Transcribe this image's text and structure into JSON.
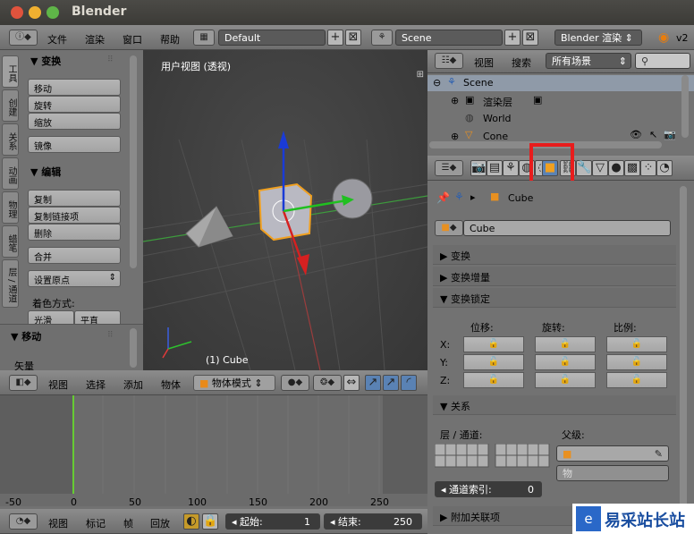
{
  "window": {
    "title": "Blender"
  },
  "top_header": {
    "menus": [
      "文件",
      "渲染",
      "窗口",
      "帮助"
    ],
    "screen_layout": "Default",
    "scene": "Scene",
    "render_engine": "Blender 渲染",
    "version": "v2"
  },
  "tool_shelf": {
    "tabs": [
      "工具",
      "创建",
      "关系",
      "动画",
      "物理",
      "蜡笔",
      "层 / 通道"
    ],
    "transform_header": "▼ 变换",
    "transform_buttons": [
      "移动",
      "旋转",
      "缩放",
      "镜像"
    ],
    "edit_header": "▼ 编辑",
    "edit_buttons": [
      "复制",
      "复制链接项",
      "删除",
      "合并"
    ],
    "set_origin": "设置原点",
    "shading_label": "着色方式:",
    "shading_buttons": [
      "光滑",
      "平直"
    ],
    "operator_header": "▼ 移动",
    "operator_field": "矢量"
  },
  "viewport": {
    "label": "用户视图 (透视)",
    "object_label": "(1) Cube"
  },
  "view3d_header": {
    "menus": [
      "视图",
      "选择",
      "添加",
      "物体"
    ],
    "mode": "物体模式"
  },
  "outliner": {
    "menus": [
      "视图",
      "搜索"
    ],
    "filter": "所有场景",
    "tree": [
      {
        "label": "Scene"
      },
      {
        "label": "渲染层"
      },
      {
        "label": "World"
      },
      {
        "label": "Cone"
      }
    ]
  },
  "properties": {
    "breadcrumb": "Cube",
    "object_name": "Cube",
    "panels": {
      "transform": "▶ 变换",
      "delta_transform": "▶ 变换增量",
      "transform_lock": "▼ 变换锁定",
      "relations": "▼ 关系",
      "attach": "▶ 附加关联项"
    },
    "lock_columns": [
      "位移:",
      "旋转:",
      "比例:"
    ],
    "lock_rows": [
      "X:",
      "Y:",
      "Z:"
    ],
    "layers_label": "层 / 通道:",
    "parent_label": "父级:",
    "pass_index_label": "通道索引:",
    "pass_index_value": "0",
    "parent_type_placeholder": "物"
  },
  "timeline": {
    "ticks": [
      "-50",
      "0",
      "50",
      "100",
      "150",
      "200",
      "250"
    ],
    "current_frame": 0
  },
  "timeline_header": {
    "menus": [
      "视图",
      "标记",
      "帧",
      "回放"
    ],
    "start_label": "起始:",
    "start_value": "1",
    "end_label": "结束:",
    "end_value": "250"
  },
  "watermark": {
    "text": "易采站长站"
  },
  "colors": {
    "accent_highlight": "#e81c1c",
    "timeline_cursor": "#66cc33",
    "outliner_selected": "#8f9aa8"
  }
}
